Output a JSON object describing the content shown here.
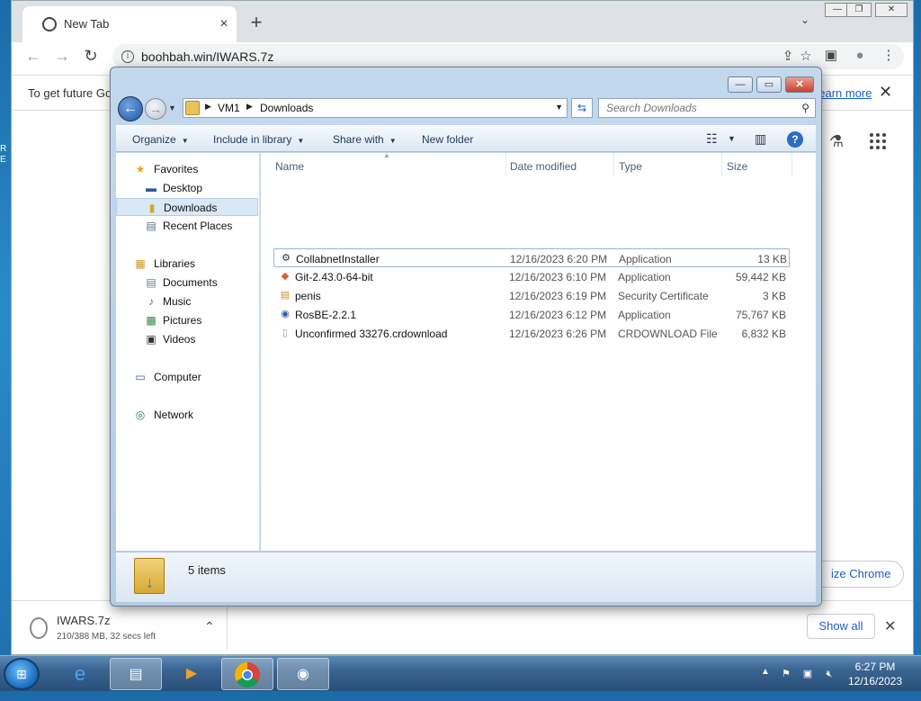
{
  "desktop": {
    "side_text": "R E"
  },
  "browser": {
    "tab_title": "New Tab",
    "tab_close": "×",
    "new_tab": "+",
    "tab_search": "⌄",
    "window_controls": {
      "minimize": "—",
      "restore": "❐",
      "close": "✕"
    },
    "back": "←",
    "forward": "→",
    "reload": "↻",
    "url": "boohbah.win/IWARS.7z",
    "share": "⇪",
    "bookmark": "☆",
    "side_panel": "▣",
    "profile": "●",
    "menu": "⋮",
    "infobar_message": "To get future Go",
    "infobar_link": "Learn more",
    "infobar_close": "✕",
    "labs": "⚗",
    "apps": "⋮⋮⋮",
    "customize": "ize Chrome"
  },
  "download": {
    "file_name": "IWARS.7z",
    "status": "210/388 MB, 32 secs left",
    "chevron": "⌃",
    "show_all": "Show all",
    "close": "✕"
  },
  "explorer": {
    "caption": {
      "minimize": "—",
      "maximize": "▭",
      "close": "✕"
    },
    "breadcrumb": [
      "VM1",
      "Downloads"
    ],
    "search_placeholder": "Search Downloads",
    "commands": {
      "organize": "Organize",
      "include_in_library": "Include in library",
      "share_with": "Share with",
      "new_folder": "New folder"
    },
    "nav": {
      "favorites": "Favorites",
      "desktop": "Desktop",
      "downloads": "Downloads",
      "recent_places": "Recent Places",
      "libraries": "Libraries",
      "documents": "Documents",
      "music": "Music",
      "pictures": "Pictures",
      "videos": "Videos",
      "computer": "Computer",
      "network": "Network"
    },
    "columns": {
      "name": "Name",
      "date_modified": "Date modified",
      "type": "Type",
      "size": "Size"
    },
    "files": [
      {
        "name": "CollabnetInstaller",
        "date": "12/16/2023 6:20 PM",
        "type": "Application",
        "size": "13 KB",
        "icon": "installer-icon"
      },
      {
        "name": "Git-2.43.0-64-bit",
        "date": "12/16/2023 6:10 PM",
        "type": "Application",
        "size": "59,442 KB",
        "icon": "git-icon"
      },
      {
        "name": "penis",
        "date": "12/16/2023 6:19 PM",
        "type": "Security Certificate",
        "size": "3 KB",
        "icon": "certificate-icon"
      },
      {
        "name": "RosBE-2.2.1",
        "date": "12/16/2023 6:12 PM",
        "type": "Application",
        "size": "75,767 KB",
        "icon": "rosbe-icon"
      },
      {
        "name": "Unconfirmed 33276.crdownload",
        "date": "12/16/2023 6:26 PM",
        "type": "CRDOWNLOAD File",
        "size": "6,832 KB",
        "icon": "blank-file-icon"
      }
    ],
    "item_count": "5 items"
  },
  "taskbar": {
    "time": "6:27 PM",
    "date": "12/16/2023"
  }
}
